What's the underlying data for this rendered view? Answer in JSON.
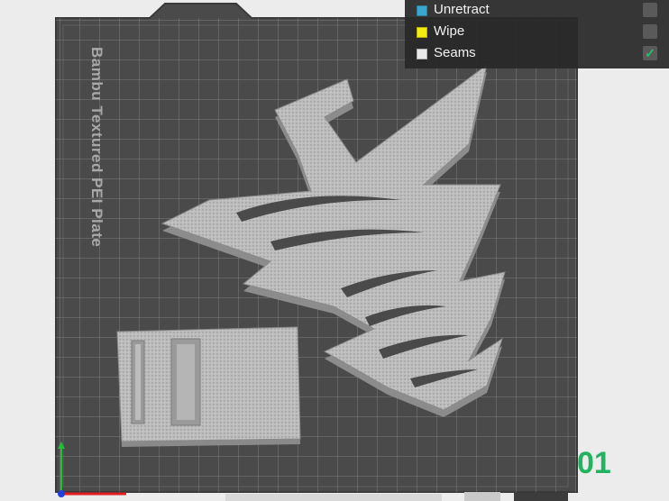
{
  "plate": {
    "name": "Bambu Textured PEI Plate",
    "number": "01"
  },
  "legend": {
    "items": [
      {
        "label": "Unretract",
        "color": "#3ba7cf",
        "checked": false
      },
      {
        "label": "Wipe",
        "color": "#f2ec10",
        "checked": false
      },
      {
        "label": "Seams",
        "color": "#eaeaea",
        "checked": true
      }
    ]
  },
  "colors": {
    "background": "#ececec",
    "plate": "#4b4b4b",
    "grid": "#7c7c7c",
    "model": "#b9b9b9",
    "accent": "#22b35e"
  }
}
